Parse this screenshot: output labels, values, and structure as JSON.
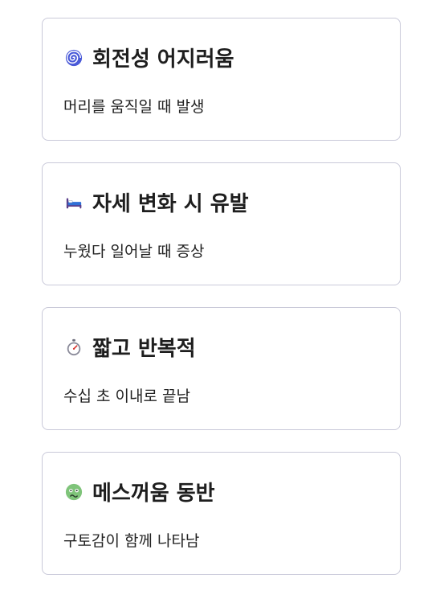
{
  "cards": [
    {
      "icon": "spiral-icon",
      "title": "회전성 어지러움",
      "description": "머리를 움직일 때 발생"
    },
    {
      "icon": "bed-icon",
      "title": "자세 변화 시 유발",
      "description": "누웠다 일어날 때 증상"
    },
    {
      "icon": "stopwatch-icon",
      "title": "짧고 반복적",
      "description": "수십 초 이내로 끝남"
    },
    {
      "icon": "nauseated-face-icon",
      "title": "메스꺼움 동반",
      "description": "구토감이 함께 나타남"
    }
  ]
}
